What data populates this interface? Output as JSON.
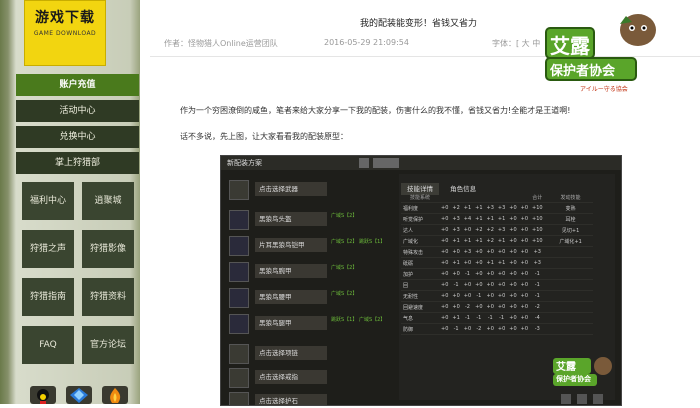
{
  "sidebar": {
    "logo_title": "游戏下载",
    "logo_sub": "GAME DOWNLOAD",
    "menu": [
      "账户充值",
      "活动中心",
      "兑换中心",
      "掌上狩猎部"
    ],
    "grid": [
      "福利中心",
      "逍聚城",
      "狩猎之声",
      "狩猎影像",
      "狩猎指南",
      "狩猎资料",
      "FAQ",
      "官方论坛"
    ]
  },
  "article": {
    "title": "我的配装能变形！省钱又省力",
    "author": "作者：怪物猎人Online运营团队",
    "date": "2016-05-29 21:09:54",
    "font": "字体：[ 大  中",
    "para1": "作为一个穷困潦倒的咸鱼，笔者来给大家分享一下我的配装，伤害什么的我不懂，省钱又省力!全能才是王道啊!",
    "para2": "话不多说，先上图，让大家看看我的配装原型："
  },
  "logo": {
    "main": "艾露",
    "sub": "保护者协会",
    "tag": "アイルー守る協会"
  },
  "embed": {
    "header": "新配装方案",
    "slots": [
      {
        "name": "点击选择武器",
        "tag": ""
      },
      {
        "name": "黑狼鸟头盔",
        "tag": "广域S【2】"
      },
      {
        "name": "片耳黑狼鸟铠甲",
        "tag": "广域S【2】 跳跃S【1】"
      },
      {
        "name": "黑狼鸟腕甲",
        "tag": "广域S【2】"
      },
      {
        "name": "黑狼鸟腰甲",
        "tag": "广域S【2】"
      },
      {
        "name": "黑狼鸟腿甲",
        "tag": "跳跃S【1】 广域S【2】"
      },
      {
        "name": "点击选择项链",
        "tag": ""
      },
      {
        "name": "点击选择戒指",
        "tag": ""
      },
      {
        "name": "点击选择护石",
        "tag": ""
      }
    ],
    "tabs": [
      "技能详情",
      "角色信息"
    ],
    "headers": [
      "技能系统",
      "",
      "",
      "",
      "",
      "",
      "",
      "",
      "",
      "合计",
      "",
      "发动技能"
    ],
    "rows": [
      [
        "福利度",
        "+0",
        "+2",
        "+1",
        "+1",
        "+3",
        "+3",
        "+0",
        "+0",
        "+10",
        "",
        "变熟"
      ],
      [
        "听觉保护",
        "+0",
        "+3",
        "+4",
        "+1",
        "+1",
        "+1",
        "+0",
        "+0",
        "+10",
        "",
        "耳栓"
      ],
      [
        "达人",
        "+0",
        "+3",
        "+0",
        "+2",
        "+2",
        "+3",
        "+0",
        "+0",
        "+10",
        "",
        "见切+1"
      ],
      [
        "广域化",
        "+0",
        "+1",
        "+1",
        "+1",
        "+2",
        "+1",
        "+0",
        "+0",
        "+10",
        "",
        "广域化+1"
      ],
      [
        "特殊攻击",
        "+0",
        "+0",
        "+3",
        "+0",
        "+0",
        "+0",
        "+0",
        "+0",
        "+3",
        "",
        ""
      ],
      [
        "砥砺",
        "+0",
        "+1",
        "+0",
        "+0",
        "+1",
        "+1",
        "+0",
        "+0",
        "+3",
        "",
        ""
      ],
      [
        "加护",
        "+0",
        "+0",
        "-1",
        "+0",
        "+0",
        "+0",
        "+0",
        "+0",
        "-1",
        "",
        ""
      ],
      [
        "回",
        "+0",
        "-1",
        "+0",
        "+0",
        "+0",
        "+0",
        "+0",
        "+0",
        "-1",
        "",
        ""
      ],
      [
        "无耐性",
        "+0",
        "+0",
        "+0",
        "-1",
        "+0",
        "+0",
        "+0",
        "+0",
        "-1",
        "",
        ""
      ],
      [
        "回避速度",
        "+0",
        "+0",
        "-2",
        "+0",
        "+0",
        "+0",
        "+0",
        "+0",
        "-2",
        "",
        ""
      ],
      [
        "气息",
        "+0",
        "+1",
        "-1",
        "-1",
        "-1",
        "-1",
        "+0",
        "+0",
        "-4",
        "",
        ""
      ],
      [
        "防御",
        "+0",
        "-1",
        "+0",
        "-2",
        "+0",
        "+0",
        "+0",
        "+0",
        "-3",
        "",
        ""
      ]
    ]
  }
}
